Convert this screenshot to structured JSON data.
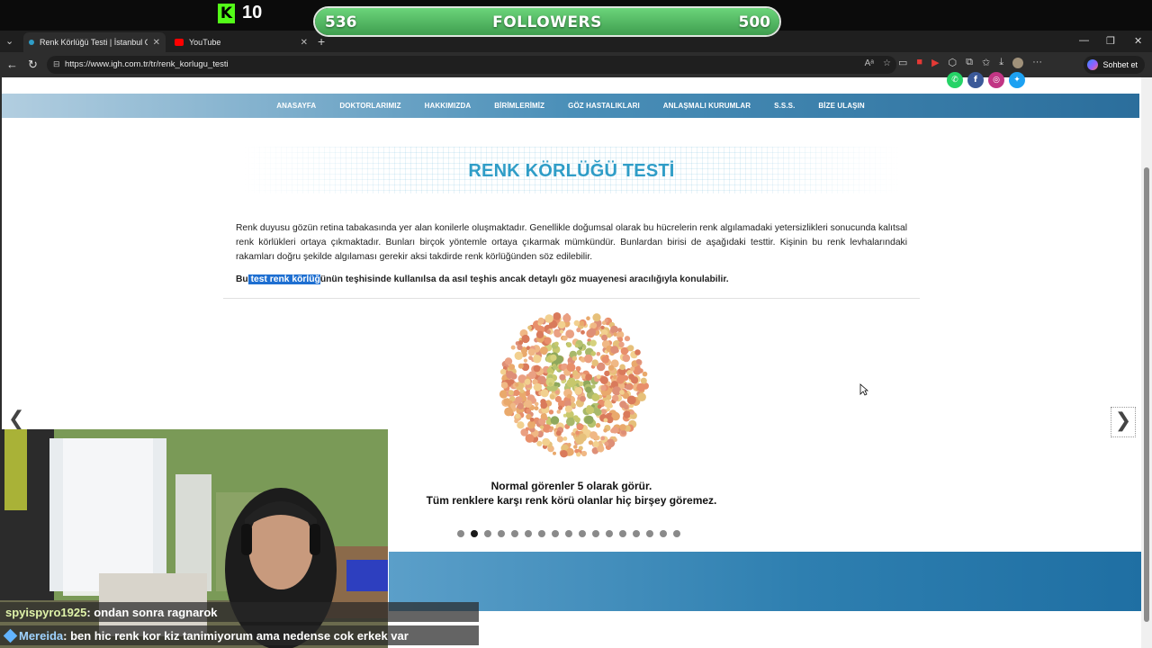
{
  "overlay": {
    "kick_count": "10",
    "followers": {
      "current": "536",
      "label": "FOLLOWERS",
      "goal": "500",
      "progress": 1.0
    }
  },
  "browser": {
    "tabs": [
      {
        "title": "Renk Körlüğü Testi | İstanbul Göz Hastanesi",
        "active": true
      },
      {
        "title": "YouTube",
        "active": false
      }
    ],
    "url": "https://www.igh.com.tr/tr/renk_korlugu_testi",
    "copilot_label": "Sohbet et"
  },
  "site": {
    "menu": [
      "ANASAYFA",
      "DOKTORLARIMIZ",
      "HAKKIMIZDA",
      "BİRİMLERİMİZ",
      "GÖZ HASTALIKLARI",
      "ANLAŞMALI KURUMLAR",
      "S.S.S.",
      "BİZE ULAŞIN"
    ],
    "title": "RENK KÖRLÜĞÜ TESTİ",
    "intro": "Renk duyusu gözün retina tabakasında yer alan konilerle oluşmaktadır. Genellikle doğumsal olarak bu hücrelerin renk algılamadaki yetersizlikleri sonucunda kalıtsal renk körlükleri ortaya çıkmaktadır. Bunları birçok yöntemle ortaya çıkarmak mümkündür. Bunlardan birisi de aşağıdaki testtir. Kişinin bu renk levhalarındaki rakamları doğru şekilde algılaması gerekir aksi takdirde renk körlüğünden söz edilebilir.",
    "note_pre": "Bu",
    "note_selected": " test renk körlüğ",
    "note_post": "ünün teşhisinde kullanılsa da asıl teşhis ancak detaylı göz muayenesi aracılığıyla konulabilir.",
    "caption_line1": "Normal görenler 5 olarak görür.",
    "caption_line2": "Tüm renklere karşı renk körü olanlar hiç birşey göremez.",
    "slide_count": 17,
    "active_slide": 2
  },
  "chat": [
    {
      "user": "spyispyro1925",
      "message": ": ondan sonra ragnarok"
    },
    {
      "user": "Mereida",
      "message": ": ben hic renk kor kiz tanimiyorum ama nedense cok erkek var"
    }
  ],
  "colors": {
    "kick_green": "#53fc18",
    "title_blue": "#2f9dc7",
    "menu_blue": "#2b6e9c",
    "selection": "#1e6fd1"
  }
}
